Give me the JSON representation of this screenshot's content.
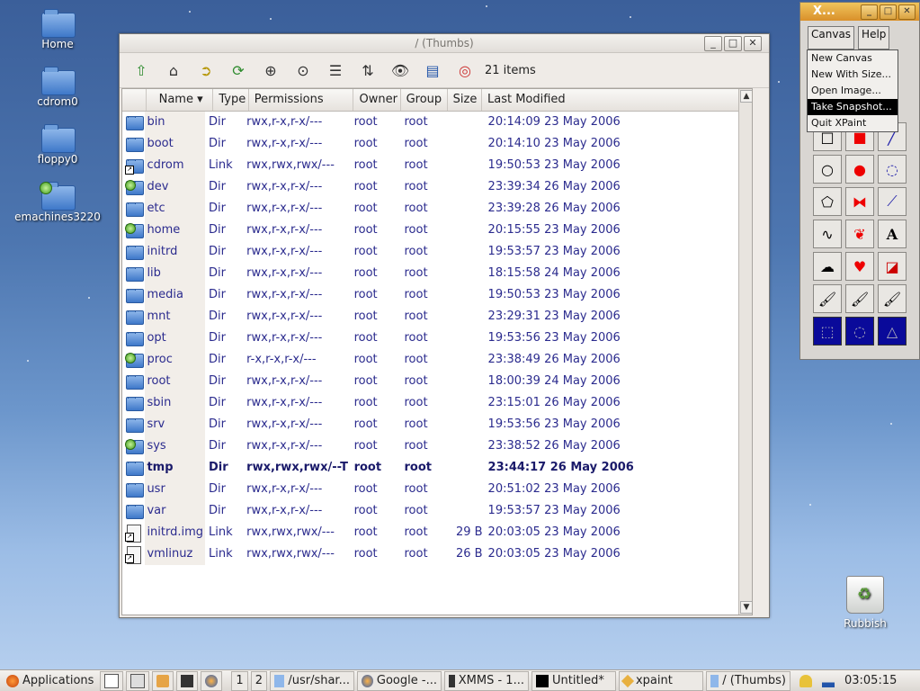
{
  "desktop": {
    "icons": [
      {
        "label": "Home"
      },
      {
        "label": "cdrom0"
      },
      {
        "label": "floppy0"
      },
      {
        "label": "emachines3220"
      }
    ],
    "rubbish_label": "Rubbish"
  },
  "fm": {
    "title": "/ (Thumbs)",
    "items_count": "21 items",
    "columns": {
      "name": "Name",
      "type": "Type",
      "permissions": "Permissions",
      "owner": "Owner",
      "group": "Group",
      "size": "Size",
      "modified": "Last Modified"
    },
    "rows": [
      {
        "icon": "folder",
        "name": "bin",
        "type": "Dir",
        "perm": "rwx,r-x,r-x/---",
        "owner": "root",
        "group": "root",
        "size": "",
        "mod": "20:14:09 23 May 2006"
      },
      {
        "icon": "folder",
        "name": "boot",
        "type": "Dir",
        "perm": "rwx,r-x,r-x/---",
        "owner": "root",
        "group": "root",
        "size": "",
        "mod": "20:14:10 23 May 2006"
      },
      {
        "icon": "folder-link",
        "name": "cdrom",
        "type": "Link",
        "perm": "rwx,rwx,rwx/---",
        "owner": "root",
        "group": "root",
        "size": "",
        "mod": "19:50:53 23 May 2006"
      },
      {
        "icon": "folder-mount",
        "name": "dev",
        "type": "Dir",
        "perm": "rwx,r-x,r-x/---",
        "owner": "root",
        "group": "root",
        "size": "",
        "mod": "23:39:34 26 May 2006"
      },
      {
        "icon": "folder",
        "name": "etc",
        "type": "Dir",
        "perm": "rwx,r-x,r-x/---",
        "owner": "root",
        "group": "root",
        "size": "",
        "mod": "23:39:28 26 May 2006"
      },
      {
        "icon": "folder-mount",
        "name": "home",
        "type": "Dir",
        "perm": "rwx,r-x,r-x/---",
        "owner": "root",
        "group": "root",
        "size": "",
        "mod": "20:15:55 23 May 2006"
      },
      {
        "icon": "folder",
        "name": "initrd",
        "type": "Dir",
        "perm": "rwx,r-x,r-x/---",
        "owner": "root",
        "group": "root",
        "size": "",
        "mod": "19:53:57 23 May 2006"
      },
      {
        "icon": "folder",
        "name": "lib",
        "type": "Dir",
        "perm": "rwx,r-x,r-x/---",
        "owner": "root",
        "group": "root",
        "size": "",
        "mod": "18:15:58 24 May 2006"
      },
      {
        "icon": "folder",
        "name": "media",
        "type": "Dir",
        "perm": "rwx,r-x,r-x/---",
        "owner": "root",
        "group": "root",
        "size": "",
        "mod": "19:50:53 23 May 2006"
      },
      {
        "icon": "folder",
        "name": "mnt",
        "type": "Dir",
        "perm": "rwx,r-x,r-x/---",
        "owner": "root",
        "group": "root",
        "size": "",
        "mod": "23:29:31 23 May 2006"
      },
      {
        "icon": "folder",
        "name": "opt",
        "type": "Dir",
        "perm": "rwx,r-x,r-x/---",
        "owner": "root",
        "group": "root",
        "size": "",
        "mod": "19:53:56 23 May 2006"
      },
      {
        "icon": "folder-mount",
        "name": "proc",
        "type": "Dir",
        "perm": "r-x,r-x,r-x/---",
        "owner": "root",
        "group": "root",
        "size": "",
        "mod": "23:38:49 26 May 2006"
      },
      {
        "icon": "folder",
        "name": "root",
        "type": "Dir",
        "perm": "rwx,r-x,r-x/---",
        "owner": "root",
        "group": "root",
        "size": "",
        "mod": "18:00:39 24 May 2006"
      },
      {
        "icon": "folder",
        "name": "sbin",
        "type": "Dir",
        "perm": "rwx,r-x,r-x/---",
        "owner": "root",
        "group": "root",
        "size": "",
        "mod": "23:15:01 26 May 2006"
      },
      {
        "icon": "folder",
        "name": "srv",
        "type": "Dir",
        "perm": "rwx,r-x,r-x/---",
        "owner": "root",
        "group": "root",
        "size": "",
        "mod": "19:53:56 23 May 2006"
      },
      {
        "icon": "folder-mount",
        "name": "sys",
        "type": "Dir",
        "perm": "rwx,r-x,r-x/---",
        "owner": "root",
        "group": "root",
        "size": "",
        "mod": "23:38:52 26 May 2006"
      },
      {
        "icon": "folder",
        "name": "tmp",
        "type": "Dir",
        "perm": "rwx,rwx,rwx/--T",
        "owner": "root",
        "group": "root",
        "size": "",
        "mod": "23:44:17 26 May 2006",
        "bold": true
      },
      {
        "icon": "folder",
        "name": "usr",
        "type": "Dir",
        "perm": "rwx,r-x,r-x/---",
        "owner": "root",
        "group": "root",
        "size": "",
        "mod": "20:51:02 23 May 2006"
      },
      {
        "icon": "folder",
        "name": "var",
        "type": "Dir",
        "perm": "rwx,r-x,r-x/---",
        "owner": "root",
        "group": "root",
        "size": "",
        "mod": "19:53:57 23 May 2006"
      },
      {
        "icon": "file-link",
        "name": "initrd.img",
        "type": "Link",
        "perm": "rwx,rwx,rwx/---",
        "owner": "root",
        "group": "root",
        "size": "29 B",
        "mod": "20:03:05 23 May 2006"
      },
      {
        "icon": "file-link",
        "name": "vmlinuz",
        "type": "Link",
        "perm": "rwx,rwx,rwx/---",
        "owner": "root",
        "group": "root",
        "size": "26 B",
        "mod": "20:03:05 23 May 2006"
      }
    ]
  },
  "xpaint": {
    "title": "X...",
    "menu_canvas": "Canvas",
    "menu_help": "Help",
    "dropdown": [
      "New Canvas",
      "New With Size...",
      "Open Image...",
      "Take Snapshot...",
      "Quit XPaint"
    ],
    "dropdown_selected": "Take Snapshot..."
  },
  "taskbar": {
    "applications": "Applications",
    "workspace1": "1",
    "workspace2": "2",
    "tasks": [
      "/usr/shar...",
      "Google -...",
      "XMMS - 1...",
      "Untitled*",
      "xpaint",
      "/ (Thumbs)"
    ],
    "clock": "03:05:15"
  }
}
